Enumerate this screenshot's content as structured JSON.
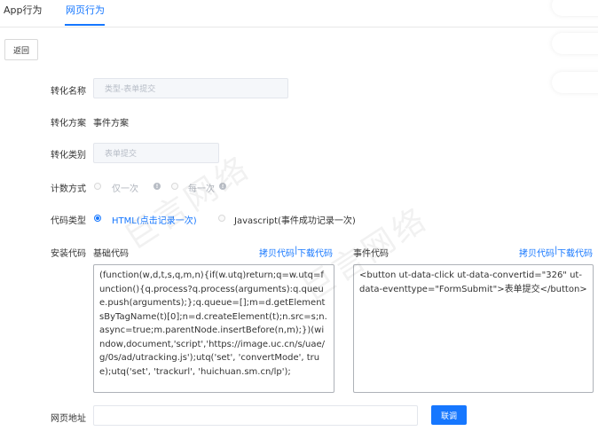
{
  "tabs": [
    {
      "label": "App行为"
    },
    {
      "label": "网页行为"
    }
  ],
  "back_button": "返回",
  "form": {
    "conversion_name": {
      "label": "转化名称",
      "placeholder": "类型-表单提交"
    },
    "conversion_scheme": {
      "label": "转化方案",
      "value": "事件方案"
    },
    "conversion_category": {
      "label": "转化类别",
      "placeholder": "表单提交"
    },
    "count_method": {
      "label": "计数方式",
      "options": [
        "仅一次",
        "每一次"
      ]
    },
    "code_type": {
      "label": "代码类型",
      "options": [
        "HTML(点击记录一次)",
        "Javascript(事件成功记录一次)"
      ],
      "selected": "HTML(点击记录一次)"
    },
    "install_code": {
      "label": "安装代码",
      "base": {
        "title": "基础代码",
        "copy_link": "拷贝代码",
        "separator": "|",
        "download_link": "下载代码",
        "code": "(function(w,d,t,s,q,m,n){if(w.utq)return;q=w.utq=function(){q.process?q.process(arguments):q.queue.push(arguments);};q.queue=[];m=d.getElementsByTagName(t)[0];n=d.createElement(t);n.src=s;n.async=true;m.parentNode.insertBefore(n,m);})(window,document,'script','https://image.uc.cn/s/uae/g/0s/ad/utracking.js');utq('set', 'convertMode', true);utq('set', 'trackurl', 'huichuan.sm.cn/lp');"
      },
      "event": {
        "title": "事件代码",
        "copy_link": "拷贝代码",
        "separator": "|",
        "download_link": "下载代码",
        "code": "<button ut-data-click ut-data-convertid=\"326\" ut-data-eventtype=\"FormSubmit\">表单提交</button>"
      }
    },
    "page_url": {
      "label": "网页地址",
      "value": ""
    },
    "jump_button": "联调"
  },
  "watermark": "巨言网络",
  "colors": {
    "accent": "#1677ff",
    "input_bg": "#f5f7fa",
    "border": "#d9d9d9",
    "muted_text": "#b0b5bd"
  },
  "icons": {
    "info": "info-icon",
    "radio": "radio-button"
  }
}
